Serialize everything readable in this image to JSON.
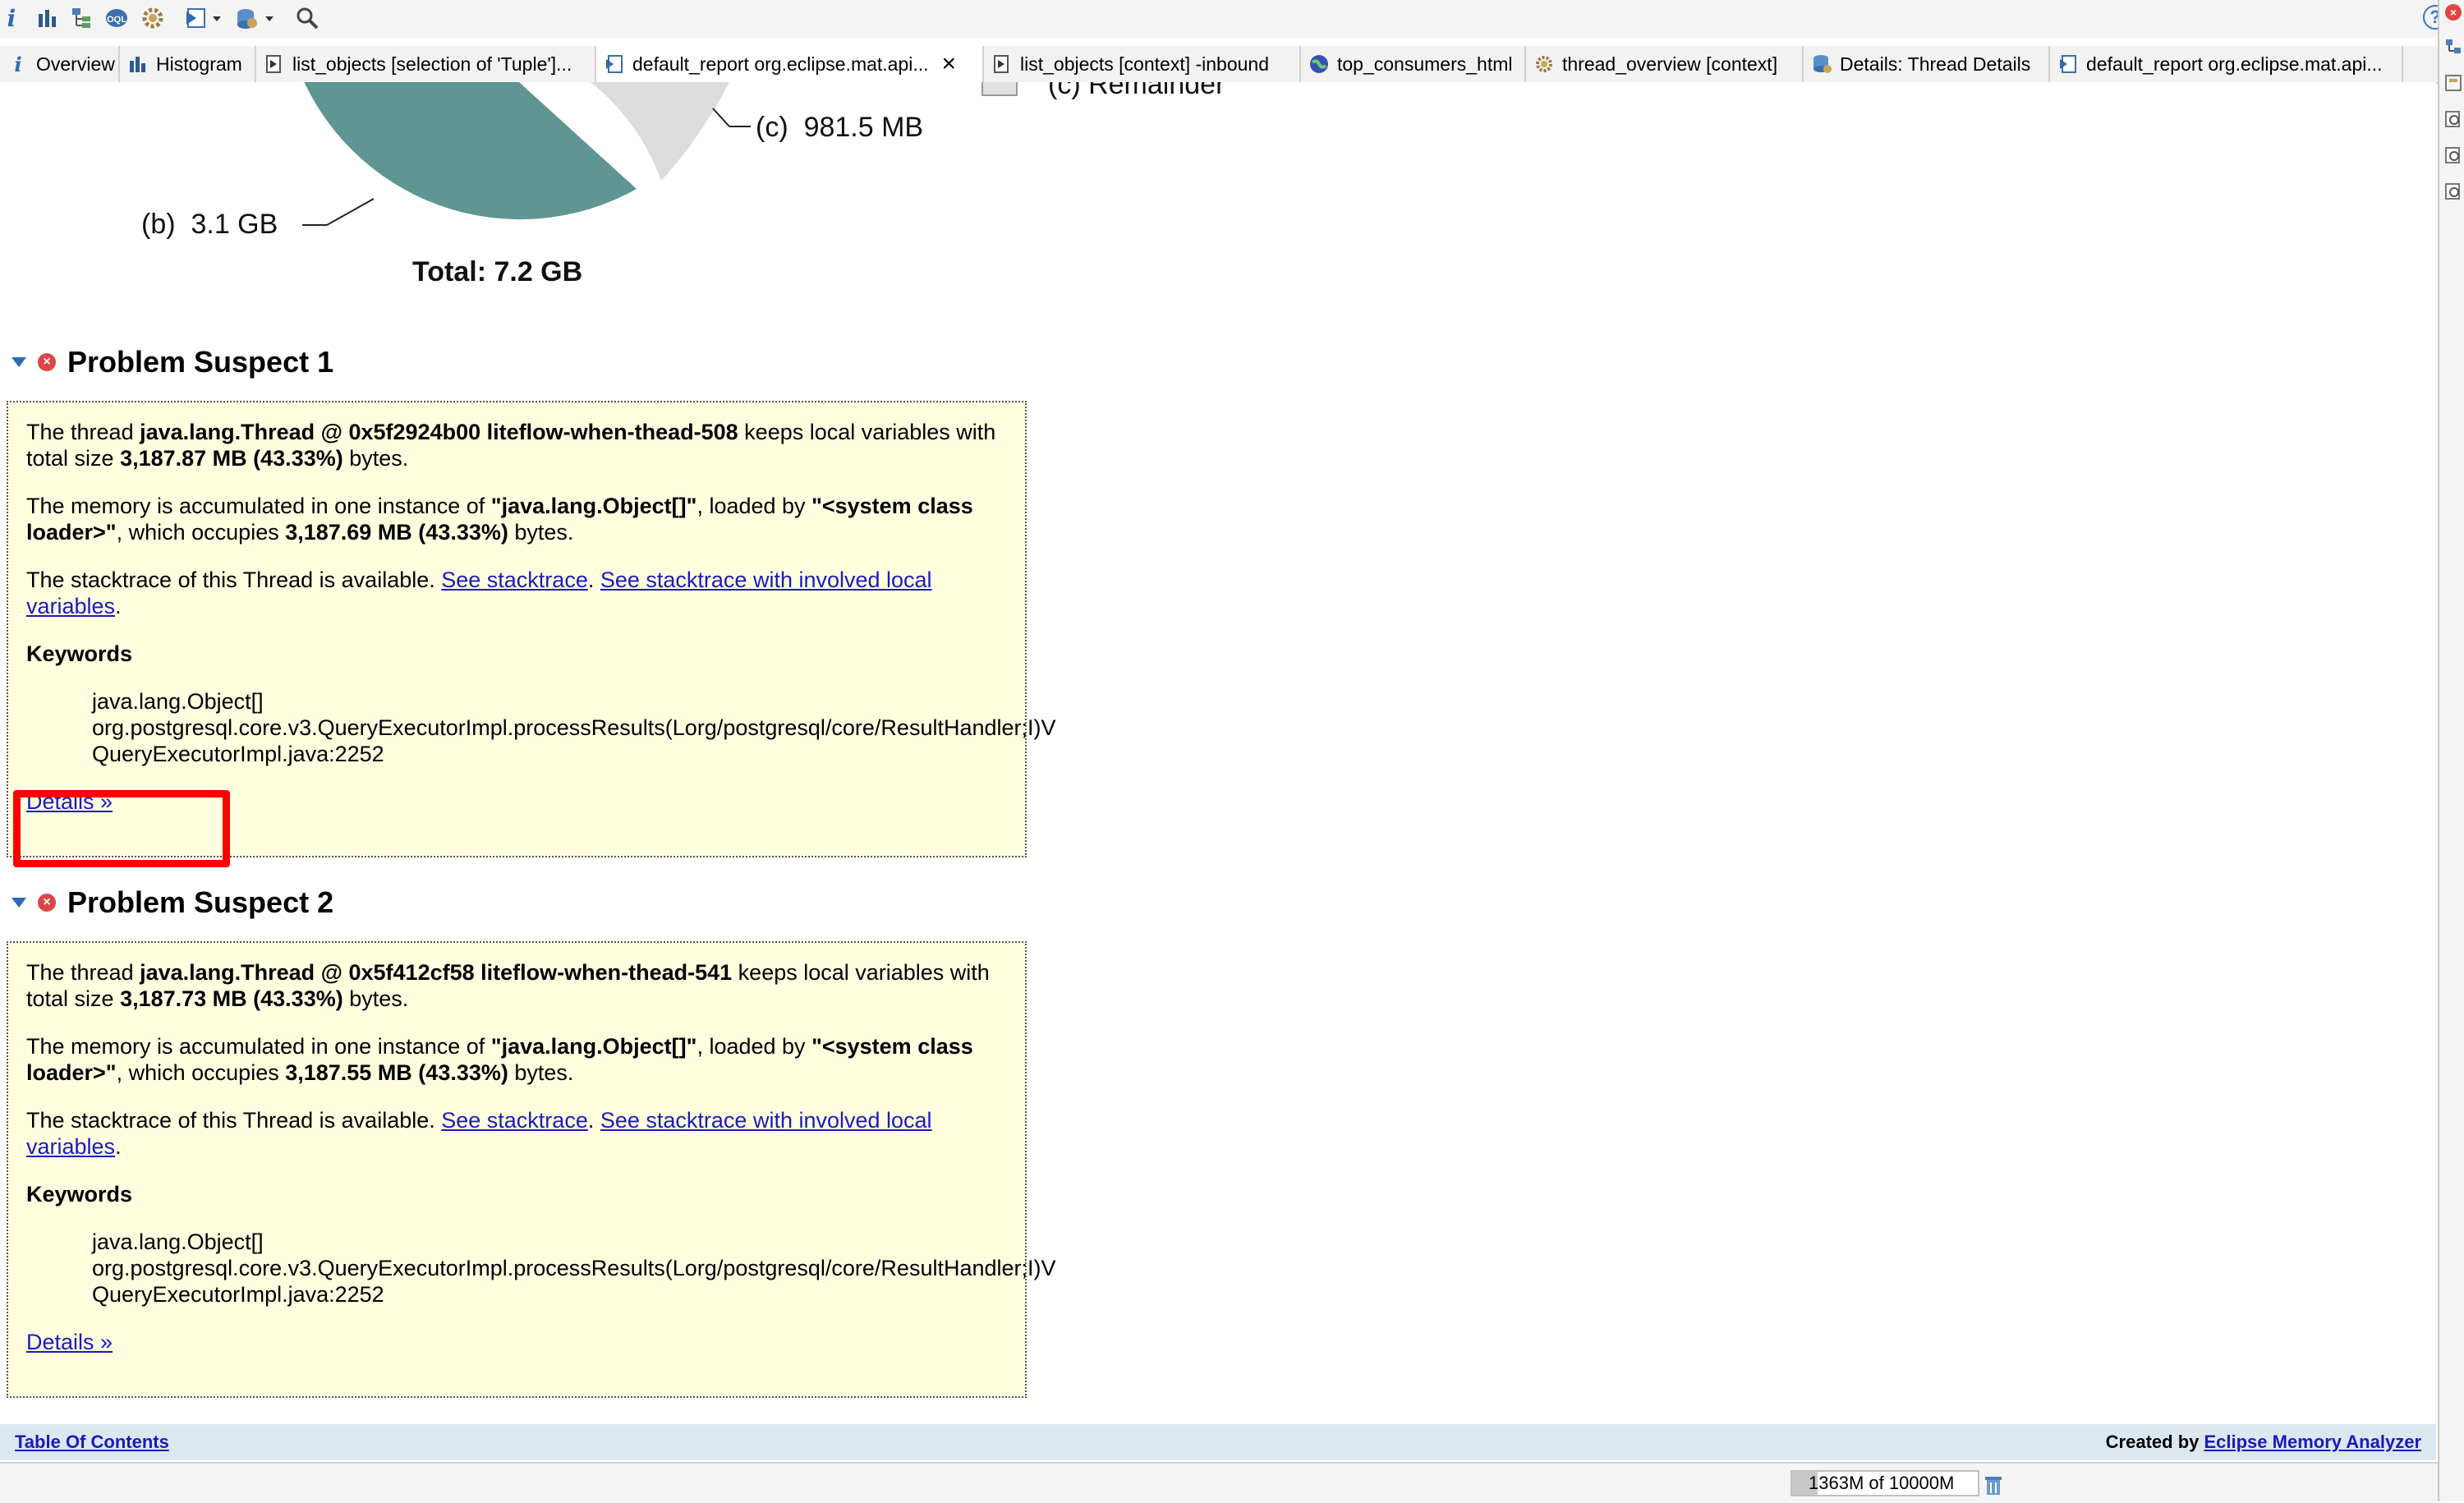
{
  "tabs": [
    {
      "label": "Overview",
      "icon": "info-icon"
    },
    {
      "label": "Histogram",
      "icon": "histogram-icon"
    },
    {
      "label": "list_objects  [selection of 'Tuple']...",
      "icon": "list-objects-icon"
    },
    {
      "label": "default_report  org.eclipse.mat.api...",
      "icon": "report-icon",
      "active": true,
      "closable": true
    },
    {
      "label": "list_objects  [context] -inbound",
      "icon": "list-objects-icon"
    },
    {
      "label": "top_consumers_html",
      "icon": "globe-icon"
    },
    {
      "label": "thread_overview  [context]",
      "icon": "gears-icon"
    },
    {
      "label": "Details: Thread Details",
      "icon": "database-icon"
    },
    {
      "label": "default_report  org.eclipse.mat.api...",
      "icon": "report-icon"
    }
  ],
  "chart_data": {
    "type": "pie",
    "title": "Total: 7.2 GB",
    "slices": [
      {
        "label": "(b)",
        "value_text": "3.1 GB",
        "value_gb": 3.1,
        "color": "#5f9593"
      },
      {
        "label": "(c)",
        "value_text": "981.5 MB",
        "value_gb": 0.98,
        "color": "#dcdcdc"
      }
    ],
    "legend_partial": "(c)  Remainder"
  },
  "suspects": [
    {
      "title": "Problem Suspect 1",
      "thread_prefix": "The thread ",
      "thread_name": "java.lang.Thread @ 0x5f2924b00 liteflow-when-thead-508",
      "thread_mid": " keeps local variables with total size ",
      "thread_size": "3,187.87 MB (43.33%)",
      "thread_suffix": " bytes.",
      "mem_prefix": "The memory is accumulated in one instance of ",
      "mem_class": "\"java.lang.Object[]\"",
      "mem_mid": ", loaded by ",
      "mem_loader": "\"<system class loader>\"",
      "mem_mid2": ", which occupies ",
      "mem_size": "3,187.69 MB (43.33%)",
      "mem_suffix": " bytes.",
      "stack_prefix": "The stacktrace of this Thread is available. ",
      "stack_link1": "See stacktrace",
      "stack_sep": ". ",
      "stack_link2": "See stacktrace with involved local variables",
      "stack_end": ".",
      "keywords_title": "Keywords",
      "keywords": [
        "java.lang.Object[]",
        "org.postgresql.core.v3.QueryExecutorImpl.processResults(Lorg/postgresql/core/ResultHandler;I)V",
        "QueryExecutorImpl.java:2252"
      ],
      "details_label": "Details »"
    },
    {
      "title": "Problem Suspect 2",
      "thread_prefix": "The thread ",
      "thread_name": "java.lang.Thread @ 0x5f412cf58 liteflow-when-thead-541",
      "thread_mid": " keeps local variables with total size ",
      "thread_size": "3,187.73 MB (43.33%)",
      "thread_suffix": " bytes.",
      "mem_prefix": "The memory is accumulated in one instance of ",
      "mem_class": "\"java.lang.Object[]\"",
      "mem_mid": ", loaded by ",
      "mem_loader": "\"<system class loader>\"",
      "mem_mid2": ", which occupies ",
      "mem_size": "3,187.55 MB (43.33%)",
      "mem_suffix": " bytes.",
      "stack_prefix": "The stacktrace of this Thread is available. ",
      "stack_link1": "See stacktrace",
      "stack_sep": ". ",
      "stack_link2": "See stacktrace with involved local variables",
      "stack_end": ".",
      "keywords_title": "Keywords",
      "keywords": [
        "java.lang.Object[]",
        "org.postgresql.core.v3.QueryExecutorImpl.processResults(Lorg/postgresql/core/ResultHandler;I)V",
        "QueryExecutorImpl.java:2252"
      ],
      "details_label": "Details »"
    }
  ],
  "footer": {
    "toc_label": "Table Of Contents",
    "created_by": "Created by ",
    "mat_link": "Eclipse Memory Analyzer"
  },
  "status": {
    "heap_text": "1363M of 10000M",
    "heap_used_fraction": 0.1363
  },
  "colors": {
    "highlight": "#ff0000",
    "suspect_bg": "#ffffe0",
    "link": "#1a1ac0"
  }
}
